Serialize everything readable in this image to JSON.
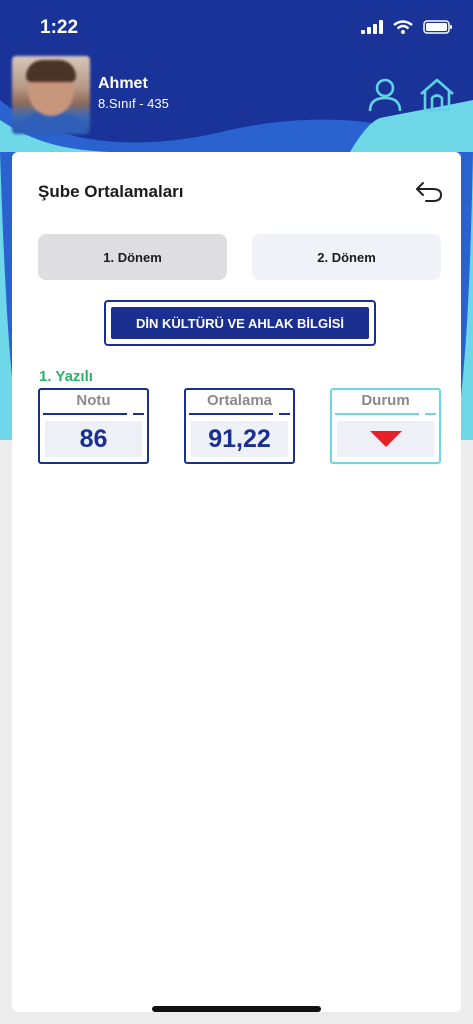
{
  "status_bar": {
    "time": "1:22"
  },
  "profile": {
    "name": "Ahmet",
    "class_info": "8.Sınıf - 435"
  },
  "page": {
    "title": "Şube Ortalamaları"
  },
  "tabs": [
    {
      "label": "1. Dönem",
      "selected": true
    },
    {
      "label": "2. Dönem",
      "selected": false
    }
  ],
  "subject": {
    "label": "DİN KÜLTÜRÜ VE AHLAK BİLGİSİ"
  },
  "exam": {
    "label": "1. Yazılı",
    "grade": {
      "title": "Notu",
      "value": "86"
    },
    "average": {
      "title": "Ortalama",
      "value": "91,22"
    },
    "status": {
      "title": "Durum",
      "indicator": "down-arrow-icon"
    }
  },
  "colors": {
    "header_blue": "#1a3399",
    "accent_cyan": "#5fd2e4",
    "navy": "#1a2f8f",
    "section_green": "#2bb36a",
    "status_red": "#e8202a"
  }
}
